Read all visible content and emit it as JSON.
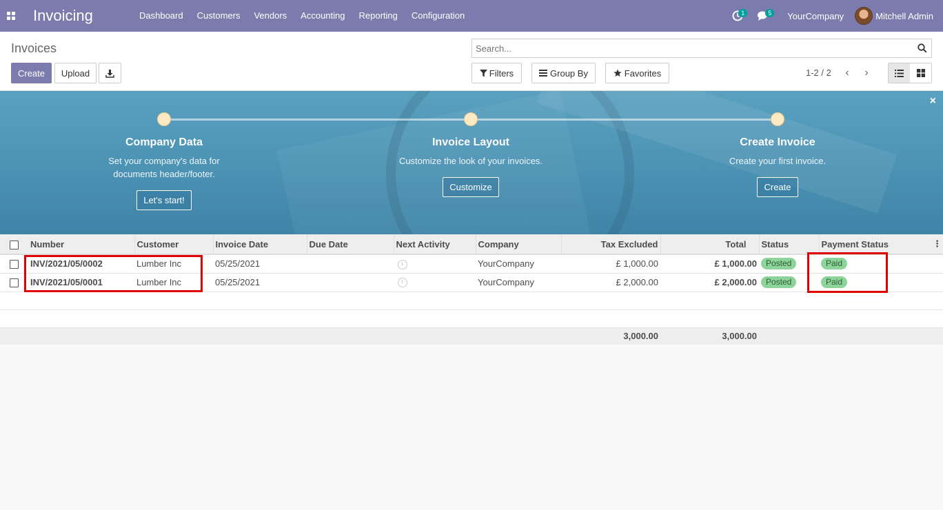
{
  "navbar": {
    "app_title": "Invoicing",
    "menu": [
      "Dashboard",
      "Customers",
      "Vendors",
      "Accounting",
      "Reporting",
      "Configuration"
    ],
    "activity_count": "1",
    "messages_count": "5",
    "company": "YourCompany",
    "user": "Mitchell Admin"
  },
  "control": {
    "breadcrumb": "Invoices",
    "create_label": "Create",
    "upload_label": "Upload",
    "search_placeholder": "Search...",
    "filters_label": "Filters",
    "groupby_label": "Group By",
    "favorites_label": "Favorites",
    "pager": "1-2 / 2"
  },
  "onboarding": {
    "steps": [
      {
        "title": "Company Data",
        "text_1": "Set your company's data for",
        "text_2": "documents header/footer.",
        "button": "Let's start!"
      },
      {
        "title": "Invoice Layout",
        "text_1": "Customize the look of your invoices.",
        "text_2": "",
        "button": "Customize"
      },
      {
        "title": "Create Invoice",
        "text_1": "Create your first invoice.",
        "text_2": "",
        "button": "Create"
      }
    ],
    "close": "×"
  },
  "table": {
    "columns": [
      "Number",
      "Customer",
      "Invoice Date",
      "Due Date",
      "Next Activity",
      "Company",
      "Tax Excluded",
      "Total",
      "Status",
      "Payment Status"
    ],
    "rows": [
      {
        "number": "INV/2021/05/0002",
        "customer": "Lumber Inc",
        "invoice_date": "05/25/2021",
        "due_date": "",
        "company": "YourCompany",
        "tax_excluded": "£ 1,000.00",
        "total": "£ 1,000.00",
        "status": "Posted",
        "payment_status": "Paid"
      },
      {
        "number": "INV/2021/05/0001",
        "customer": "Lumber Inc",
        "invoice_date": "05/25/2021",
        "due_date": "",
        "company": "YourCompany",
        "tax_excluded": "£ 2,000.00",
        "total": "£ 2,000.00",
        "status": "Posted",
        "payment_status": "Paid"
      }
    ],
    "totals": {
      "tax_excluded": "3,000.00",
      "total": "3,000.00"
    }
  },
  "colors": {
    "brand": "#7c7bad",
    "badge": "#00a09d",
    "paid_pill": "#8dd49b",
    "highlight": "#e00000"
  }
}
